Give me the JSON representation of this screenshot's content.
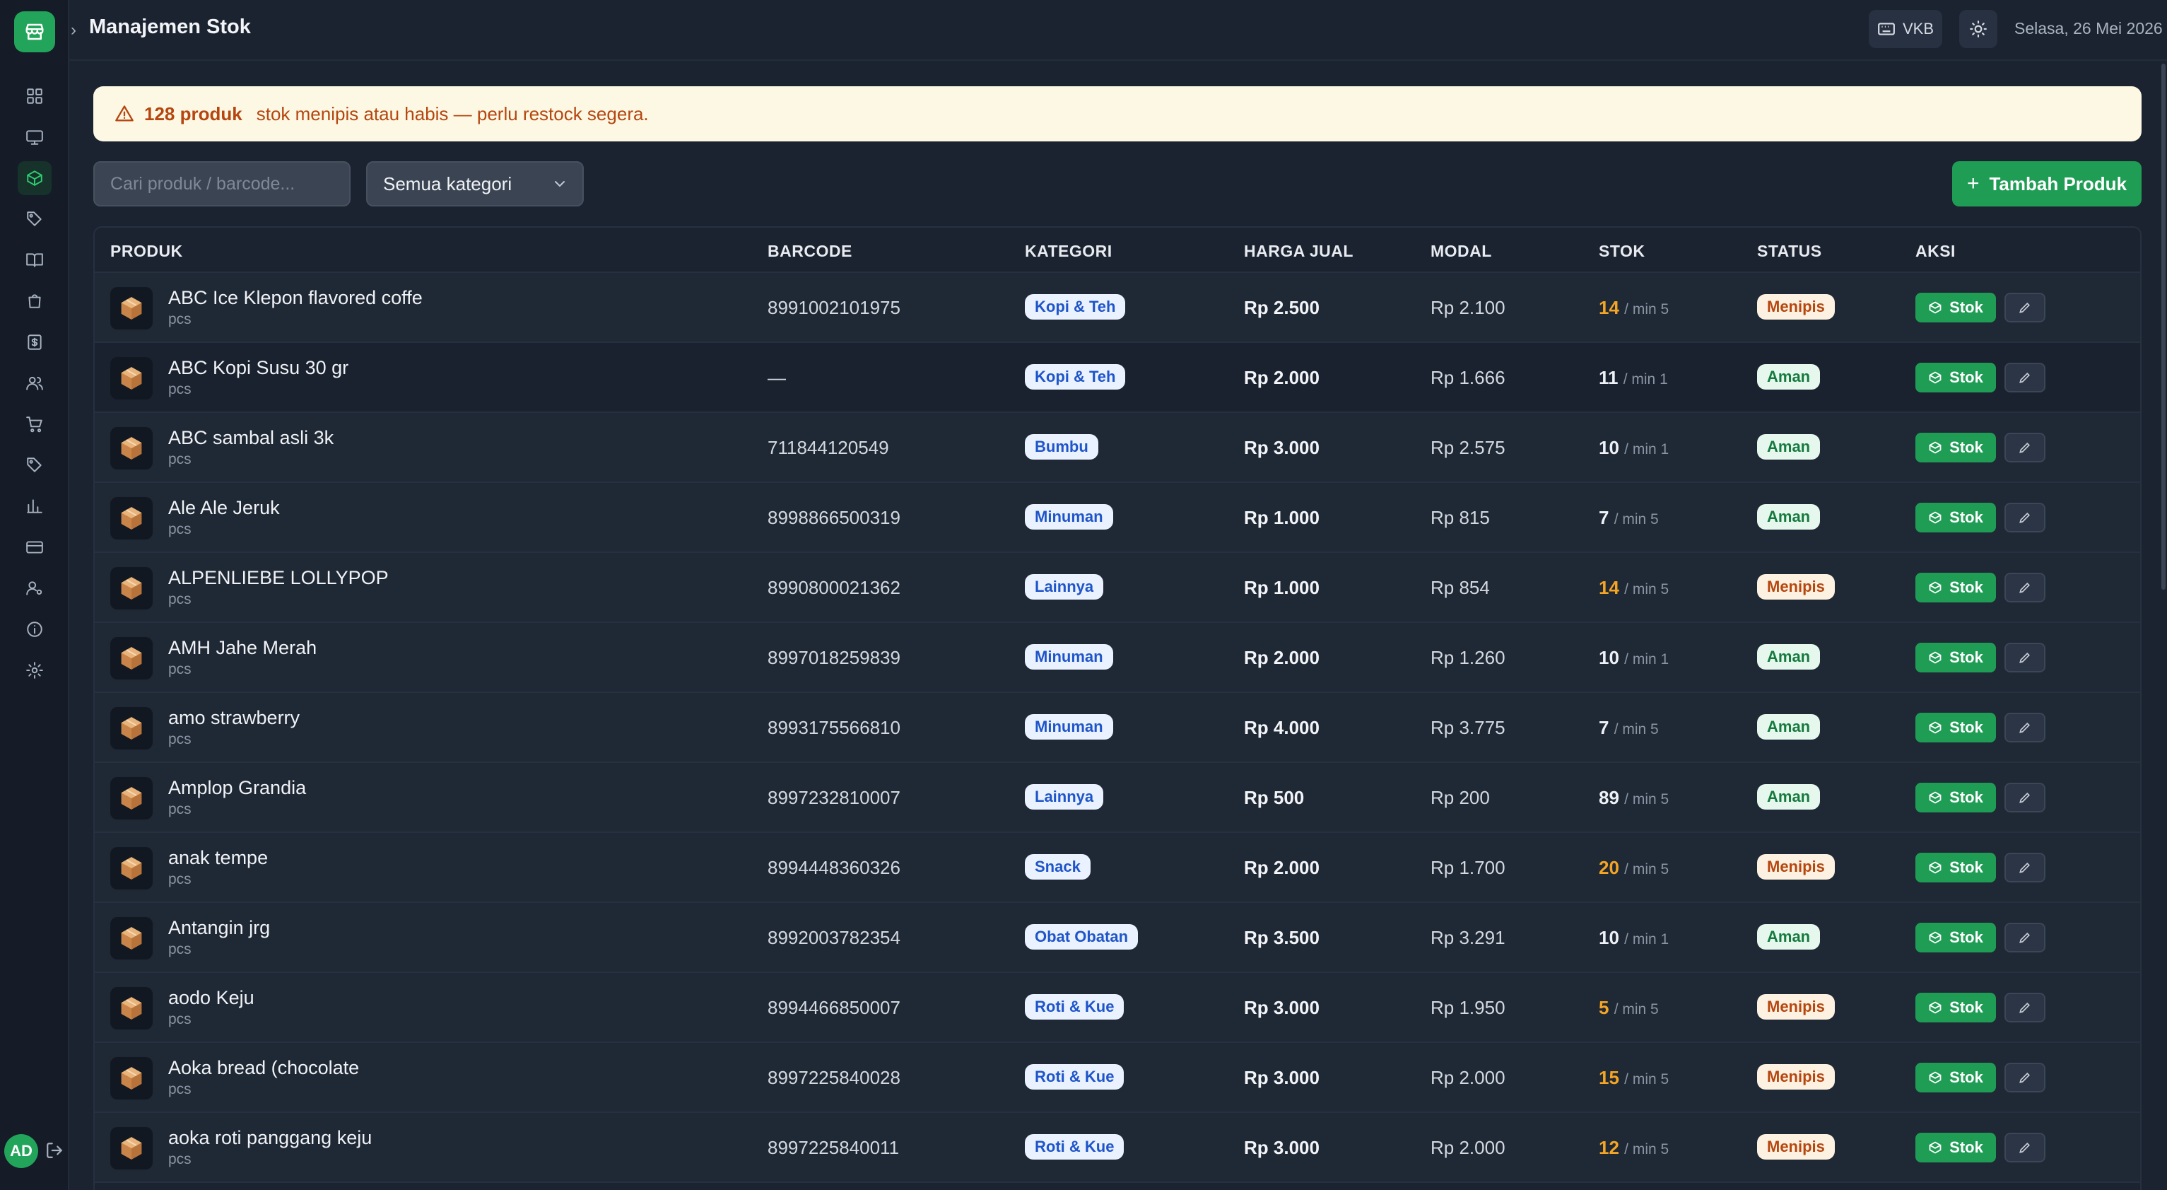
{
  "header": {
    "title": "Manajemen Stok",
    "keyboard_label": "VKB",
    "date": "Selasa, 26 Mei 2026"
  },
  "sidebar": {
    "items": [
      {
        "icon": "dashboard-icon"
      },
      {
        "icon": "monitor-icon"
      },
      {
        "icon": "box-icon",
        "active": true
      },
      {
        "icon": "tag-icon"
      },
      {
        "icon": "book-icon"
      },
      {
        "icon": "bag-icon"
      },
      {
        "icon": "dollar-icon"
      },
      {
        "icon": "users-icon"
      },
      {
        "icon": "cart-icon"
      },
      {
        "icon": "tag-icon"
      },
      {
        "icon": "chart-icon"
      },
      {
        "icon": "card-icon"
      },
      {
        "icon": "user-settings-icon"
      },
      {
        "icon": "info-icon"
      },
      {
        "icon": "gear-icon"
      }
    ],
    "avatar": "AD"
  },
  "alert": {
    "count": "128 produk",
    "message": "stok menipis atau habis — perlu restock segera."
  },
  "toolbar": {
    "search_placeholder": "Cari produk / barcode...",
    "category_selected": "Semua kategori",
    "add_label": "Tambah Produk"
  },
  "table": {
    "headers": {
      "product": "PRODUK",
      "barcode": "BARCODE",
      "category": "KATEGORI",
      "price": "HARGA JUAL",
      "cost": "MODAL",
      "stock": "STOK",
      "status": "STATUS",
      "action": "AKSI"
    },
    "stock_button": "Stok",
    "rows": [
      {
        "name": "ABC Ice Klepon flavored coffe",
        "unit": "pcs",
        "barcode": "8991002101975",
        "category": "Kopi & Teh",
        "price": "Rp 2.500",
        "cost": "Rp 2.100",
        "stock": "14",
        "min": "/ min 5",
        "status": "Menipis",
        "low": true
      },
      {
        "name": "ABC Kopi Susu 30 gr",
        "unit": "pcs",
        "barcode": "—",
        "category": "Kopi & Teh",
        "price": "Rp 2.000",
        "cost": "Rp 1.666",
        "stock": "11",
        "min": "/ min 1",
        "status": "Aman",
        "low": false
      },
      {
        "name": "ABC sambal asli 3k",
        "unit": "pcs",
        "barcode": "711844120549",
        "category": "Bumbu",
        "price": "Rp 3.000",
        "cost": "Rp 2.575",
        "stock": "10",
        "min": "/ min 1",
        "status": "Aman",
        "low": false
      },
      {
        "name": "Ale Ale Jeruk",
        "unit": "pcs",
        "barcode": "8998866500319",
        "category": "Minuman",
        "price": "Rp 1.000",
        "cost": "Rp 815",
        "stock": "7",
        "min": "/ min 5",
        "status": "Aman",
        "low": false
      },
      {
        "name": "ALPENLIEBE LOLLYPOP",
        "unit": "pcs",
        "barcode": "8990800021362",
        "category": "Lainnya",
        "price": "Rp 1.000",
        "cost": "Rp 854",
        "stock": "14",
        "min": "/ min 5",
        "status": "Menipis",
        "low": true
      },
      {
        "name": "AMH Jahe Merah",
        "unit": "pcs",
        "barcode": "8997018259839",
        "category": "Minuman",
        "price": "Rp 2.000",
        "cost": "Rp 1.260",
        "stock": "10",
        "min": "/ min 1",
        "status": "Aman",
        "low": false
      },
      {
        "name": "amo strawberry",
        "unit": "pcs",
        "barcode": "8993175566810",
        "category": "Minuman",
        "price": "Rp 4.000",
        "cost": "Rp 3.775",
        "stock": "7",
        "min": "/ min 5",
        "status": "Aman",
        "low": false
      },
      {
        "name": "Amplop Grandia",
        "unit": "pcs",
        "barcode": "8997232810007",
        "category": "Lainnya",
        "price": "Rp 500",
        "cost": "Rp 200",
        "stock": "89",
        "min": "/ min 5",
        "status": "Aman",
        "low": false
      },
      {
        "name": "anak tempe",
        "unit": "pcs",
        "barcode": "8994448360326",
        "category": "Snack",
        "price": "Rp 2.000",
        "cost": "Rp 1.700",
        "stock": "20",
        "min": "/ min 5",
        "status": "Menipis",
        "low": true
      },
      {
        "name": "Antangin jrg",
        "unit": "pcs",
        "barcode": "8992003782354",
        "category": "Obat Obatan",
        "price": "Rp 3.500",
        "cost": "Rp 3.291",
        "stock": "10",
        "min": "/ min 1",
        "status": "Aman",
        "low": false
      },
      {
        "name": "aodo Keju",
        "unit": "pcs",
        "barcode": "8994466850007",
        "category": "Roti & Kue",
        "price": "Rp 3.000",
        "cost": "Rp 1.950",
        "stock": "5",
        "min": "/ min 5",
        "status": "Menipis",
        "low": true
      },
      {
        "name": "Aoka bread (chocolate",
        "unit": "pcs",
        "barcode": "8997225840028",
        "category": "Roti & Kue",
        "price": "Rp 3.000",
        "cost": "Rp 2.000",
        "stock": "15",
        "min": "/ min 5",
        "status": "Menipis",
        "low": true
      },
      {
        "name": "aoka roti panggang keju",
        "unit": "pcs",
        "barcode": "8997225840011",
        "category": "Roti & Kue",
        "price": "Rp 3.000",
        "cost": "Rp 2.000",
        "stock": "12",
        "min": "/ min 5",
        "status": "Menipis",
        "low": true
      }
    ]
  }
}
